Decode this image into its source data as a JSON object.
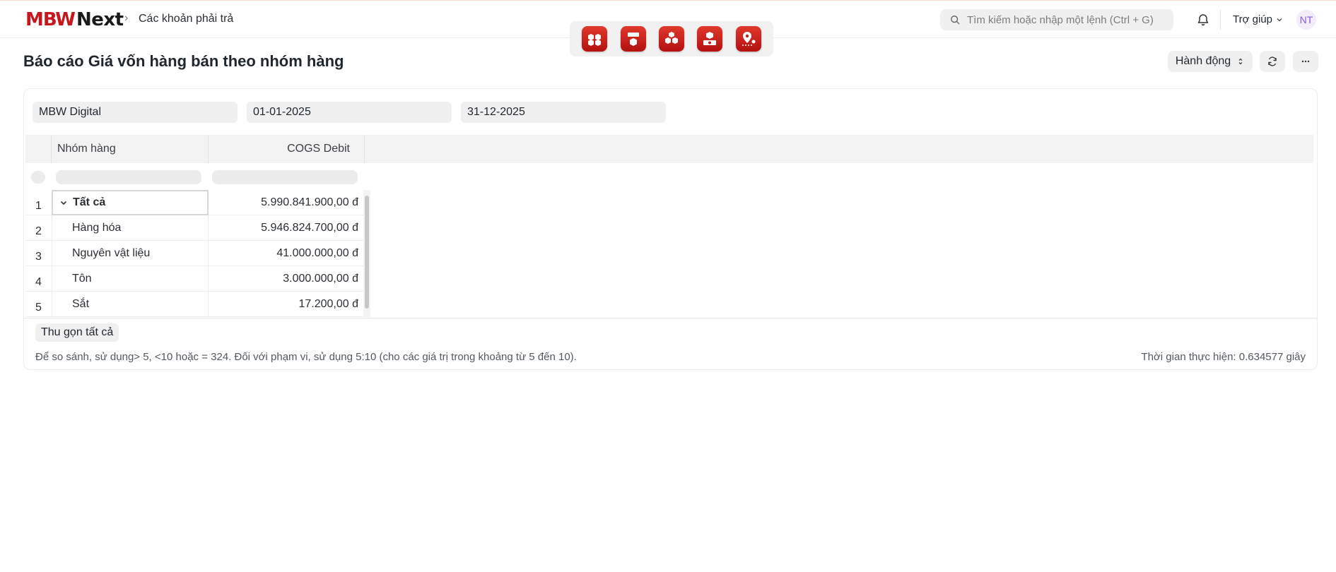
{
  "header": {
    "logo_mbw": "MBW",
    "logo_next": "Next",
    "breadcrumb": "Các khoản phải trả",
    "search_placeholder": "Tìm kiếm hoặc nhập một lệnh (Ctrl + G)",
    "help_label": "Trợ giúp",
    "avatar_initials": "NT",
    "apps": [
      {
        "icon": "boxes-icon"
      },
      {
        "icon": "box-sign-icon"
      },
      {
        "icon": "stacked-boxes-icon"
      },
      {
        "icon": "box-money-icon"
      },
      {
        "icon": "location-route-icon"
      }
    ],
    "brand_color": "#c8161d"
  },
  "page": {
    "title": "Báo cáo Giá vốn hàng bán theo nhóm hàng",
    "actions_label": "Hành động"
  },
  "filters": {
    "company": "MBW Digital",
    "from_date": "01-01-2025",
    "to_date": "31-12-2025"
  },
  "table": {
    "columns": [
      "Nhóm hàng",
      "COGS Debit"
    ],
    "rows": [
      {
        "idx": "1",
        "name": "Tất cả",
        "cogs": "5.990.841.900,00 đ"
      },
      {
        "idx": "2",
        "name": "Hàng hóa",
        "cogs": "5.946.824.700,00 đ"
      },
      {
        "idx": "3",
        "name": "Nguyên vật liệu",
        "cogs": "41.000.000,00 đ"
      },
      {
        "idx": "4",
        "name": "Tôn",
        "cogs": "3.000.000,00 đ"
      },
      {
        "idx": "5",
        "name": "Sắt",
        "cogs": "17.200,00 đ"
      }
    ]
  },
  "footer": {
    "collapse_label": "Thu gọn tất cả",
    "hint": "Để so sánh, sử dụng> 5, <10 hoặc = 324. Đối với phạm vi, sử dụng 5:10 (cho các giá trị trong khoảng từ 5 đến 10).",
    "exec_time": "Thời gian thực hiện: 0.634577 giây"
  }
}
